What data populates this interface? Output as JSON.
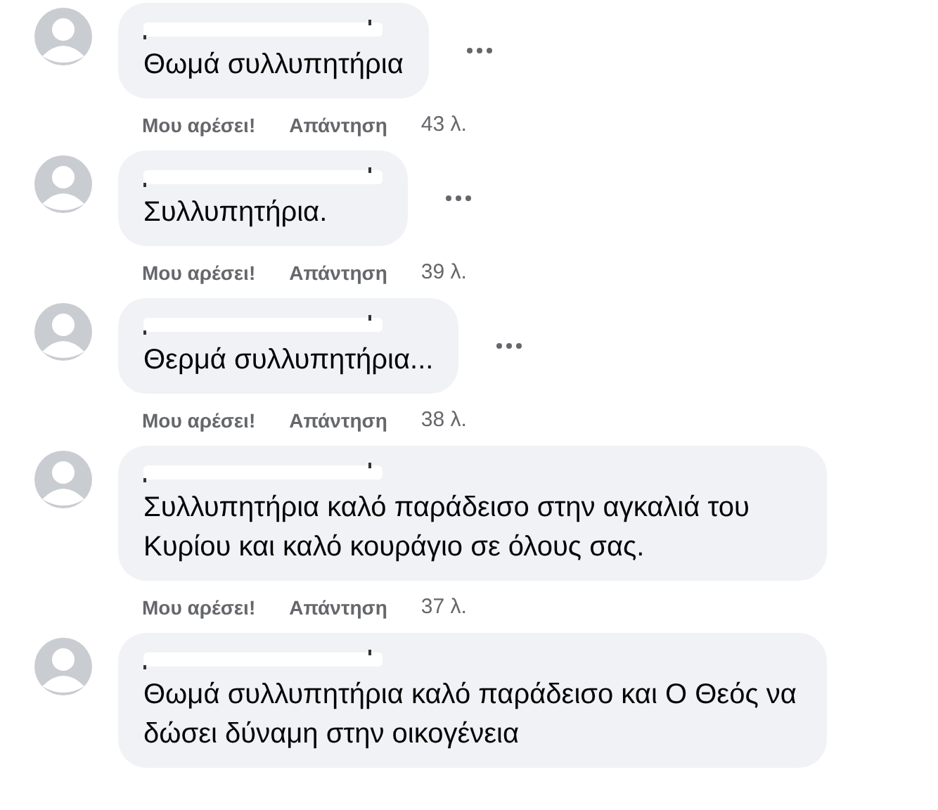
{
  "comments": [
    {
      "name_redacted": true,
      "text": "Θωμά συλλυπητήρια",
      "options_visible": true,
      "like": "Μου αρέσει!",
      "reply": "Απάντηση",
      "time": "43 λ."
    },
    {
      "name_redacted": true,
      "text": "Συλλυπητήρια.",
      "options_visible": true,
      "like": "Μου αρέσει!",
      "reply": "Απάντηση",
      "time": "39 λ."
    },
    {
      "name_redacted": true,
      "text": "Θερμά συλλυπητήρια...",
      "options_visible": true,
      "like": "Μου αρέσει!",
      "reply": "Απάντηση",
      "time": "38 λ."
    },
    {
      "name_redacted": true,
      "text": "Συλλυπητήρια καλό παράδεισο στην αγκαλιά του Κυρίου και καλό κουράγιο σε όλους σας.",
      "options_visible": false,
      "like": "Μου αρέσει!",
      "reply": "Απάντηση",
      "time": "37 λ."
    },
    {
      "name_redacted": true,
      "text": "Θωμά συλλυπητήρια καλό παράδεισο και Ο Θεός να δώσει δύναμη στην οικογένεια",
      "options_visible": false
    }
  ]
}
